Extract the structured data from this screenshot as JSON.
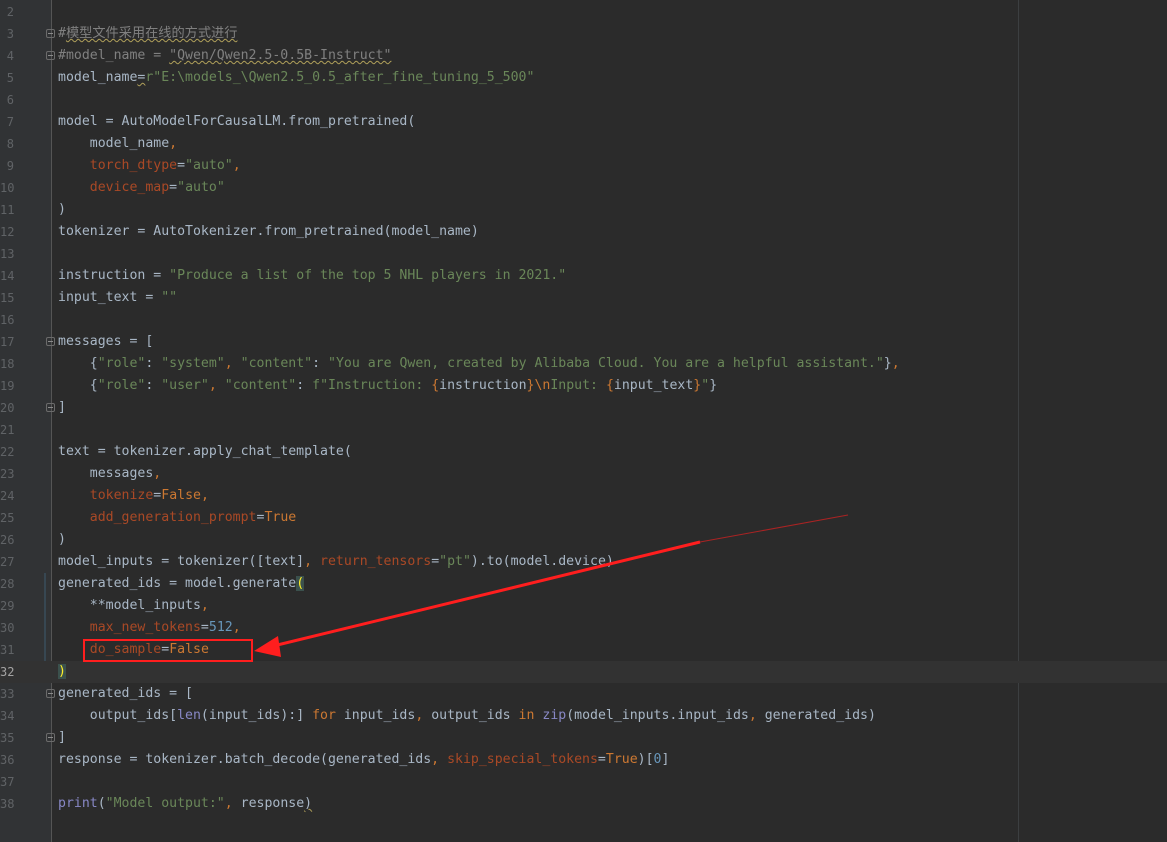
{
  "editor": {
    "language": "python",
    "current_line": "32",
    "colors": {
      "background": "#2b2b2b",
      "gutter": "#313335",
      "default_text": "#a9b7c6",
      "comment": "#808080",
      "string": "#6a8759",
      "kwarg": "#aa4926",
      "keyword": "#cc7832",
      "number": "#6897bb",
      "annotation_red": "#ff1e1e"
    },
    "lines": [
      {
        "num": "2",
        "tokens": []
      },
      {
        "num": "3",
        "fold": true,
        "tokens": [
          {
            "t": "#",
            "c": "t-comment"
          },
          {
            "t": "模型文件采用在线的方式进行",
            "c": "t-comment t-squiggle"
          }
        ]
      },
      {
        "num": "4",
        "fold": true,
        "tokens": [
          {
            "t": "#model_name = ",
            "c": "t-comment"
          },
          {
            "t": "\"Qwen/Qwen2.5-0.5B-Instruct\"",
            "c": "t-comment t-squiggle"
          }
        ]
      },
      {
        "num": "5",
        "tokens": [
          {
            "t": "model_name"
          },
          {
            "t": "=",
            "c": "t-squiggle"
          },
          {
            "t": "r\"E:\\models_\\Qwen2.5_0.5_after_fine_tuning_5_500\"",
            "c": "t-string"
          }
        ]
      },
      {
        "num": "6",
        "tokens": []
      },
      {
        "num": "7",
        "tokens": [
          {
            "t": "model = AutoModelForCausalLM.from_pretrained("
          }
        ]
      },
      {
        "num": "8",
        "tokens": [
          {
            "t": "    model_name"
          },
          {
            "t": ",",
            "c": "t-keyword"
          }
        ]
      },
      {
        "num": "9",
        "tokens": [
          {
            "t": "    "
          },
          {
            "t": "torch_dtype",
            "c": "t-kwarg"
          },
          {
            "t": "="
          },
          {
            "t": "\"auto\"",
            "c": "t-string"
          },
          {
            "t": ",",
            "c": "t-keyword"
          }
        ]
      },
      {
        "num": "10",
        "tokens": [
          {
            "t": "    "
          },
          {
            "t": "device_map",
            "c": "t-kwarg"
          },
          {
            "t": "="
          },
          {
            "t": "\"auto\"",
            "c": "t-string"
          }
        ]
      },
      {
        "num": "11",
        "tokens": [
          {
            "t": ")"
          }
        ]
      },
      {
        "num": "12",
        "tokens": [
          {
            "t": "tokenizer = AutoTokenizer.from_pretrained(model_name)"
          }
        ]
      },
      {
        "num": "13",
        "tokens": []
      },
      {
        "num": "14",
        "tokens": [
          {
            "t": "instruction = "
          },
          {
            "t": "\"Produce a list of the top 5 NHL players in 2021.\"",
            "c": "t-string"
          }
        ]
      },
      {
        "num": "15",
        "tokens": [
          {
            "t": "input_text = "
          },
          {
            "t": "\"\"",
            "c": "t-string"
          }
        ]
      },
      {
        "num": "16",
        "tokens": []
      },
      {
        "num": "17",
        "fold": true,
        "tokens": [
          {
            "t": "messages = ["
          }
        ]
      },
      {
        "num": "18",
        "tokens": [
          {
            "t": "    {"
          },
          {
            "t": "\"role\"",
            "c": "t-string"
          },
          {
            "t": ": "
          },
          {
            "t": "\"system\"",
            "c": "t-string"
          },
          {
            "t": ", ",
            "c": "t-keyword"
          },
          {
            "t": "\"content\"",
            "c": "t-string"
          },
          {
            "t": ": "
          },
          {
            "t": "\"You are Qwen, created by Alibaba Cloud. You are a helpful assistant.\"",
            "c": "t-string"
          },
          {
            "t": "}"
          },
          {
            "t": ",",
            "c": "t-keyword"
          }
        ]
      },
      {
        "num": "19",
        "tokens": [
          {
            "t": "    {"
          },
          {
            "t": "\"role\"",
            "c": "t-string"
          },
          {
            "t": ": "
          },
          {
            "t": "\"user\"",
            "c": "t-string"
          },
          {
            "t": ", ",
            "c": "t-keyword"
          },
          {
            "t": "\"content\"",
            "c": "t-string"
          },
          {
            "t": ": "
          },
          {
            "t": "f\"Instruction: ",
            "c": "t-string"
          },
          {
            "t": "{",
            "c": "t-keyword"
          },
          {
            "t": "instruction"
          },
          {
            "t": "}",
            "c": "t-keyword"
          },
          {
            "t": "\\n",
            "c": "t-keyword"
          },
          {
            "t": "Input: ",
            "c": "t-string"
          },
          {
            "t": "{",
            "c": "t-keyword"
          },
          {
            "t": "input_text"
          },
          {
            "t": "}",
            "c": "t-keyword"
          },
          {
            "t": "\"",
            "c": "t-string"
          },
          {
            "t": "}"
          }
        ]
      },
      {
        "num": "20",
        "fold": true,
        "tokens": [
          {
            "t": "]"
          }
        ]
      },
      {
        "num": "21",
        "tokens": []
      },
      {
        "num": "22",
        "tokens": [
          {
            "t": "text = tokenizer.apply_chat_template("
          }
        ]
      },
      {
        "num": "23",
        "tokens": [
          {
            "t": "    messages"
          },
          {
            "t": ",",
            "c": "t-keyword"
          }
        ]
      },
      {
        "num": "24",
        "tokens": [
          {
            "t": "    "
          },
          {
            "t": "tokenize",
            "c": "t-kwarg"
          },
          {
            "t": "="
          },
          {
            "t": "False",
            "c": "t-keyword"
          },
          {
            "t": ",",
            "c": "t-keyword"
          }
        ]
      },
      {
        "num": "25",
        "tokens": [
          {
            "t": "    "
          },
          {
            "t": "add_generation_prompt",
            "c": "t-kwarg"
          },
          {
            "t": "="
          },
          {
            "t": "True",
            "c": "t-keyword"
          }
        ]
      },
      {
        "num": "26",
        "tokens": [
          {
            "t": ")"
          }
        ]
      },
      {
        "num": "27",
        "tokens": [
          {
            "t": "model_inputs = tokenizer([text]"
          },
          {
            "t": ", ",
            "c": "t-keyword"
          },
          {
            "t": "return_tensors",
            "c": "t-kwarg"
          },
          {
            "t": "="
          },
          {
            "t": "\"pt\"",
            "c": "t-string"
          },
          {
            "t": ").to(model.device)"
          }
        ]
      },
      {
        "num": "28",
        "tokens": [
          {
            "t": "generated_ids = model.generate"
          },
          {
            "t": "(",
            "c": "t-brace-match"
          }
        ]
      },
      {
        "num": "29",
        "tokens": [
          {
            "t": "    **model_inputs"
          },
          {
            "t": ",",
            "c": "t-keyword"
          }
        ]
      },
      {
        "num": "30",
        "tokens": [
          {
            "t": "    "
          },
          {
            "t": "max_new_tokens",
            "c": "t-kwarg"
          },
          {
            "t": "="
          },
          {
            "t": "512",
            "c": "t-number"
          },
          {
            "t": ",",
            "c": "t-keyword"
          }
        ]
      },
      {
        "num": "31",
        "tokens": [
          {
            "t": "    "
          },
          {
            "t": "do_sample",
            "c": "t-kwarg"
          },
          {
            "t": "="
          },
          {
            "t": "False",
            "c": "t-keyword"
          }
        ]
      },
      {
        "num": "32",
        "current": true,
        "tokens": [
          {
            "t": ")",
            "c": "t-brace-match"
          }
        ]
      },
      {
        "num": "33",
        "fold": true,
        "tokens": [
          {
            "t": "generated_ids = ["
          }
        ]
      },
      {
        "num": "34",
        "tokens": [
          {
            "t": "    output_ids[",
            "c": ""
          },
          {
            "t": "len",
            "c": "t-builtin"
          },
          {
            "t": "(input_ids):] "
          },
          {
            "t": "for",
            "c": "t-keyword"
          },
          {
            "t": " input_ids"
          },
          {
            "t": ", ",
            "c": "t-keyword"
          },
          {
            "t": "output_ids "
          },
          {
            "t": "in",
            "c": "t-keyword"
          },
          {
            "t": " "
          },
          {
            "t": "zip",
            "c": "t-builtin"
          },
          {
            "t": "(model_inputs.input_ids"
          },
          {
            "t": ", ",
            "c": "t-keyword"
          },
          {
            "t": "generated_ids)"
          }
        ]
      },
      {
        "num": "35",
        "fold": true,
        "tokens": [
          {
            "t": "]"
          }
        ]
      },
      {
        "num": "36",
        "tokens": [
          {
            "t": "response = tokenizer.batch_decode(generated_ids"
          },
          {
            "t": ", ",
            "c": "t-keyword"
          },
          {
            "t": "skip_special_tokens",
            "c": "t-kwarg"
          },
          {
            "t": "="
          },
          {
            "t": "True",
            "c": "t-keyword"
          },
          {
            "t": ")["
          },
          {
            "t": "0",
            "c": "t-number"
          },
          {
            "t": "]"
          }
        ]
      },
      {
        "num": "37",
        "tokens": []
      },
      {
        "num": "38",
        "tokens": [
          {
            "t": "print",
            "c": "t-builtin"
          },
          {
            "t": "("
          },
          {
            "t": "\"Model output:\"",
            "c": "t-string"
          },
          {
            "t": ", ",
            "c": "t-keyword"
          },
          {
            "t": "response"
          },
          {
            "t": ")",
            "c": "t-squiggle"
          }
        ]
      }
    ]
  },
  "annotation": {
    "type": "red-box-with-arrow",
    "target": "do_sample=False"
  }
}
